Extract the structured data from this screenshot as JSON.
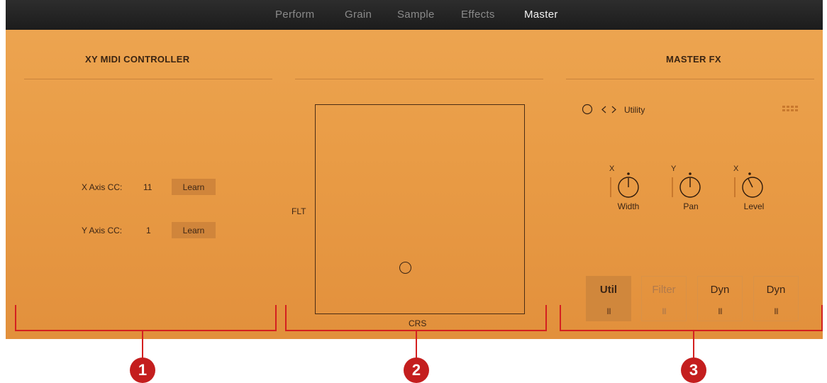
{
  "tabs": [
    {
      "label": "Perform",
      "active": false
    },
    {
      "label": "Grain",
      "active": false
    },
    {
      "label": "Sample",
      "active": false
    },
    {
      "label": "Effects",
      "active": false
    },
    {
      "label": "Master",
      "active": true
    }
  ],
  "xy_midi": {
    "title": "XY MIDI CONTROLLER",
    "x_axis": {
      "label": "X Axis CC:",
      "value": "11",
      "learn_label": "Learn"
    },
    "y_axis": {
      "label": "Y Axis CC:",
      "value": "1",
      "learn_label": "Learn"
    }
  },
  "xy_pad": {
    "y_label": "FLT",
    "x_label": "CRS"
  },
  "master_fx": {
    "title": "MASTER FX",
    "preset": "Utility",
    "icons": {
      "power": "power-toggle-icon",
      "prev": "previous-preset-icon",
      "next": "next-preset-icon",
      "grid": "grid-menu-icon"
    },
    "knobs": [
      {
        "axis": "X",
        "name": "Width"
      },
      {
        "axis": "Y",
        "name": "Pan"
      },
      {
        "axis": "X",
        "name": "Level"
      }
    ],
    "slots": [
      {
        "name": "Util",
        "grip": "||||",
        "active": true
      },
      {
        "name": "Filter",
        "grip": "||||",
        "active": false
      },
      {
        "name": "Dyn",
        "grip": "||||",
        "active": false
      },
      {
        "name": "Dyn",
        "grip": "||||",
        "active": false
      }
    ]
  },
  "callouts": [
    "1",
    "2",
    "3"
  ],
  "colors": {
    "panel": "#e99c46",
    "tabbar": "#242424",
    "callout": "#c41e1e",
    "bracket": "#d42020"
  }
}
